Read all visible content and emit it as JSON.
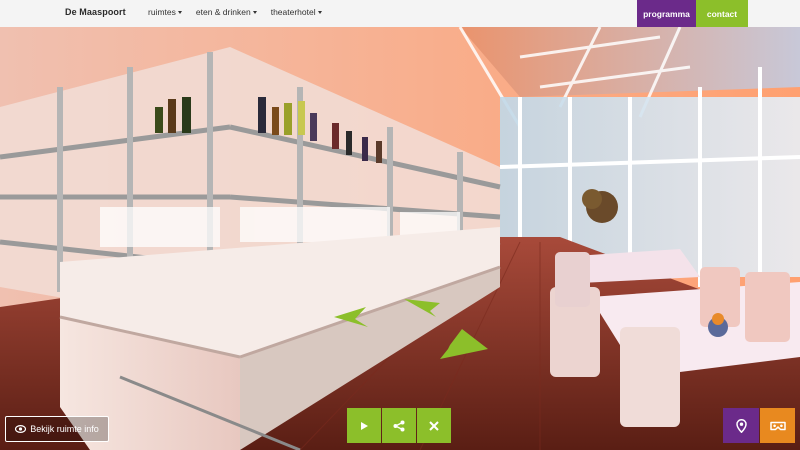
{
  "header": {
    "brand": "De Maaspoort",
    "nav": [
      {
        "label": "ruimtes"
      },
      {
        "label": "eten & drinken"
      },
      {
        "label": "theaterhotel"
      }
    ],
    "programma_label": "programma",
    "contact_label": "contact"
  },
  "controls": {
    "info_label": "Bekijk ruimte info",
    "play_icon": "play-icon",
    "share_icon": "share-icon",
    "close_icon": "close-icon",
    "location_icon": "location-pin-icon",
    "vr_icon": "vr-headset-icon"
  },
  "colors": {
    "purple": "#6b2a8a",
    "green": "#8cbf2a",
    "orange": "#e8891f"
  }
}
